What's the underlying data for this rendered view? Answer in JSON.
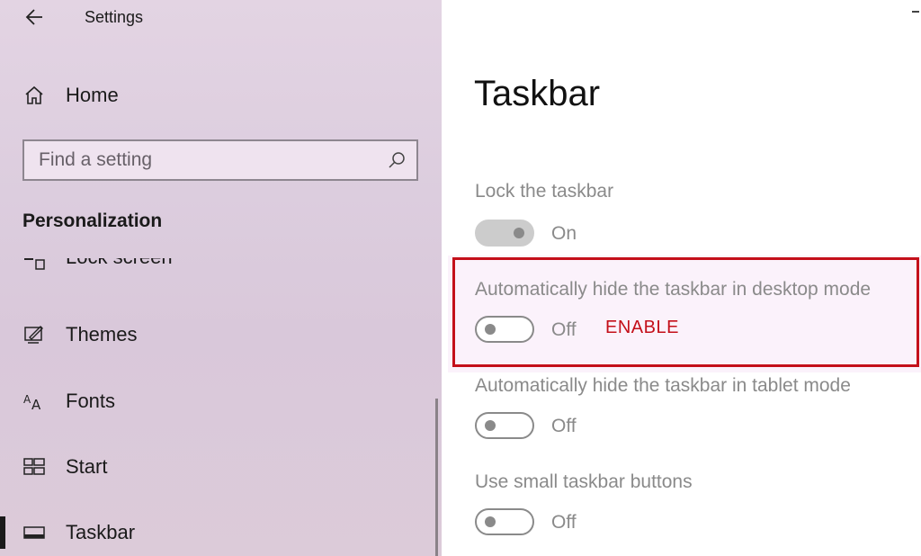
{
  "window": {
    "title": "Settings"
  },
  "sidebar": {
    "home_label": "Home",
    "search_placeholder": "Find a setting",
    "section_title": "Personalization",
    "items": [
      {
        "label": "Lock screen",
        "icon": "lock-screen-icon"
      },
      {
        "label": "Themes",
        "icon": "themes-icon"
      },
      {
        "label": "Fonts",
        "icon": "fonts-icon"
      },
      {
        "label": "Start",
        "icon": "start-icon"
      },
      {
        "label": "Taskbar",
        "icon": "taskbar-icon",
        "active": true
      }
    ]
  },
  "main": {
    "title": "Taskbar",
    "settings": [
      {
        "label": "Lock the taskbar",
        "state": "On",
        "enabled": false
      },
      {
        "label": "Automatically hide the taskbar in desktop mode",
        "state": "Off",
        "annotation": "ENABLE"
      },
      {
        "label": "Automatically hide the taskbar in tablet mode",
        "state": "Off"
      },
      {
        "label": "Use small taskbar buttons",
        "state": "Off"
      }
    ]
  },
  "colors": {
    "annotation": "#c4101a",
    "muted_text": "#8a8a8a"
  }
}
